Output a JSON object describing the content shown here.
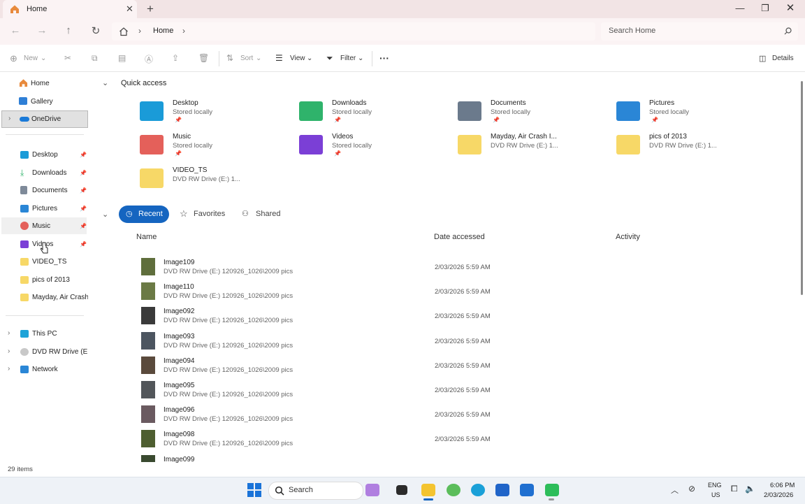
{
  "tab": {
    "title": "Home"
  },
  "address": {
    "crumb": "Home",
    "search_placeholder": "Search Home"
  },
  "toolbar": {
    "new": "New",
    "sort": "Sort",
    "view": "View",
    "filter": "Filter",
    "more": "···",
    "details": "Details"
  },
  "sidebar": {
    "top": [
      {
        "label": "Home"
      },
      {
        "label": "Gallery"
      },
      {
        "label": "OneDrive"
      }
    ],
    "pinned": [
      {
        "label": "Desktop"
      },
      {
        "label": "Downloads"
      },
      {
        "label": "Documents"
      },
      {
        "label": "Pictures"
      },
      {
        "label": "Music"
      },
      {
        "label": "Videos"
      }
    ],
    "folders": [
      {
        "label": "VIDEO_TS"
      },
      {
        "label": "pics of 2013"
      },
      {
        "label": "Mayday, Air Crash"
      }
    ],
    "devices": [
      {
        "label": "This PC"
      },
      {
        "label": "DVD RW Drive (E:) '"
      },
      {
        "label": "Network"
      }
    ]
  },
  "quick_access": {
    "title": "Quick access",
    "items": [
      {
        "name": "Desktop",
        "sub": "Stored locally",
        "color": "#1a9bd8"
      },
      {
        "name": "Downloads",
        "sub": "Stored locally",
        "color": "#2fb36b"
      },
      {
        "name": "Documents",
        "sub": "Stored locally",
        "color": "#6b7a8c"
      },
      {
        "name": "Pictures",
        "sub": "Stored locally",
        "color": "#2a86d6"
      },
      {
        "name": "Music",
        "sub": "Stored locally",
        "color": "#e4605a"
      },
      {
        "name": "Videos",
        "sub": "Stored locally",
        "color": "#7b3fd6"
      },
      {
        "name": "Mayday, Air Crash I...",
        "sub": "DVD RW Drive (E:) 1...",
        "color": "#f7d867"
      },
      {
        "name": "pics of 2013",
        "sub": "DVD RW Drive (E:) 1...",
        "color": "#f7d867"
      },
      {
        "name": "VIDEO_TS",
        "sub": "DVD RW Drive (E:) 1...",
        "color": "#f7d867"
      }
    ]
  },
  "filters": {
    "recent": "Recent",
    "favorites": "Favorites",
    "shared": "Shared"
  },
  "columns": {
    "name": "Name",
    "date": "Date accessed",
    "activity": "Activity"
  },
  "rows": [
    {
      "name": "Image109",
      "path": "DVD RW Drive (E:) 120926_1026\\2009 pics",
      "date": "2/03/2026 5:59 AM"
    },
    {
      "name": "Image110",
      "path": "DVD RW Drive (E:) 120926_1026\\2009 pics",
      "date": "2/03/2026 5:59 AM"
    },
    {
      "name": "Image092",
      "path": "DVD RW Drive (E:) 120926_1026\\2009 pics",
      "date": "2/03/2026 5:59 AM"
    },
    {
      "name": "Image093",
      "path": "DVD RW Drive (E:) 120926_1026\\2009 pics",
      "date": "2/03/2026 5:59 AM"
    },
    {
      "name": "Image094",
      "path": "DVD RW Drive (E:) 120926_1026\\2009 pics",
      "date": "2/03/2026 5:59 AM"
    },
    {
      "name": "Image095",
      "path": "DVD RW Drive (E:) 120926_1026\\2009 pics",
      "date": "2/03/2026 5:59 AM"
    },
    {
      "name": "Image096",
      "path": "DVD RW Drive (E:) 120926_1026\\2009 pics",
      "date": "2/03/2026 5:59 AM"
    },
    {
      "name": "Image098",
      "path": "DVD RW Drive (E:) 120926_1026\\2009 pics",
      "date": "2/03/2026 5:59 AM"
    },
    {
      "name": "Image099",
      "path": "",
      "date": ""
    }
  ],
  "status": {
    "items": "29 items"
  },
  "taskbar": {
    "search": "Search",
    "lang1": "ENG",
    "lang2": "US",
    "time": "6:06 PM",
    "date": "2/03/2026"
  },
  "colors": {
    "accent": "#1565c0",
    "folder": "#f7d867"
  }
}
